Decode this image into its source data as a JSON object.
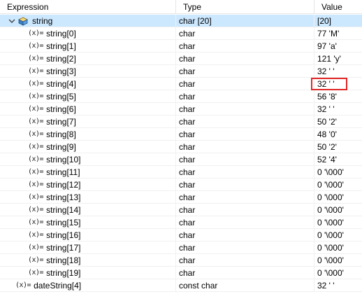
{
  "columns": {
    "expression": "Expression",
    "type": "Type",
    "value": "Value"
  },
  "rows": [
    {
      "name": "string",
      "type": "char [20]",
      "value": "[20]",
      "kind": "array",
      "expanded": true,
      "selected": true
    },
    {
      "name": "string[0]",
      "type": "char",
      "value": "77 'M'",
      "kind": "element"
    },
    {
      "name": "string[1]",
      "type": "char",
      "value": "97 'a'",
      "kind": "element"
    },
    {
      "name": "string[2]",
      "type": "char",
      "value": "121 'y'",
      "kind": "element"
    },
    {
      "name": "string[3]",
      "type": "char",
      "value": "32 ' '",
      "kind": "element"
    },
    {
      "name": "string[4]",
      "type": "char",
      "value": "32 ' '",
      "kind": "element",
      "highlighted": true
    },
    {
      "name": "string[5]",
      "type": "char",
      "value": "56 '8'",
      "kind": "element"
    },
    {
      "name": "string[6]",
      "type": "char",
      "value": "32 ' '",
      "kind": "element"
    },
    {
      "name": "string[7]",
      "type": "char",
      "value": "50 '2'",
      "kind": "element"
    },
    {
      "name": "string[8]",
      "type": "char",
      "value": "48 '0'",
      "kind": "element"
    },
    {
      "name": "string[9]",
      "type": "char",
      "value": "50 '2'",
      "kind": "element"
    },
    {
      "name": "string[10]",
      "type": "char",
      "value": "52 '4'",
      "kind": "element"
    },
    {
      "name": "string[11]",
      "type": "char",
      "value": "0 '\\000'",
      "kind": "element"
    },
    {
      "name": "string[12]",
      "type": "char",
      "value": "0 '\\000'",
      "kind": "element"
    },
    {
      "name": "string[13]",
      "type": "char",
      "value": "0 '\\000'",
      "kind": "element"
    },
    {
      "name": "string[14]",
      "type": "char",
      "value": "0 '\\000'",
      "kind": "element"
    },
    {
      "name": "string[15]",
      "type": "char",
      "value": "0 '\\000'",
      "kind": "element"
    },
    {
      "name": "string[16]",
      "type": "char",
      "value": "0 '\\000'",
      "kind": "element"
    },
    {
      "name": "string[17]",
      "type": "char",
      "value": "0 '\\000'",
      "kind": "element"
    },
    {
      "name": "string[18]",
      "type": "char",
      "value": "0 '\\000'",
      "kind": "element"
    },
    {
      "name": "string[19]",
      "type": "char",
      "value": "0 '\\000'",
      "kind": "element"
    },
    {
      "name": "dateString[4]",
      "type": "const char",
      "value": "32 ' '",
      "kind": "top-element"
    }
  ],
  "icons": {
    "variable_icon_text": "(x)=",
    "array_icon": "package-icon",
    "expand_icon": "chevron-down-icon"
  },
  "colors": {
    "selection": "#cce8ff",
    "highlight_border": "#e02626"
  }
}
